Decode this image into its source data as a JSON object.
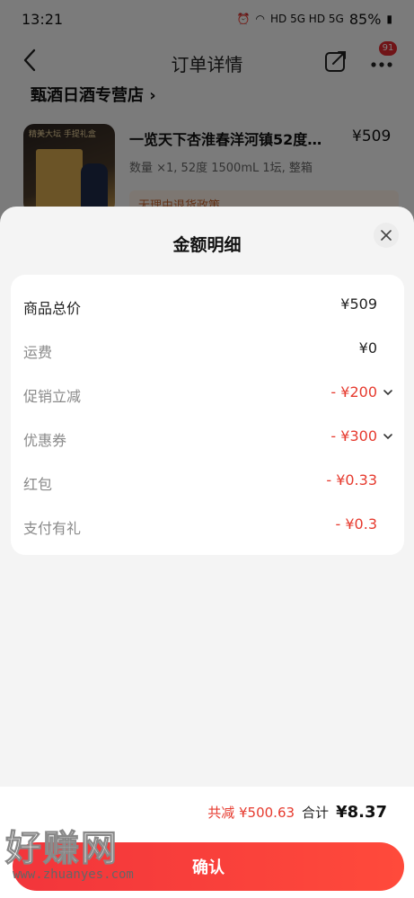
{
  "status_bar": {
    "time": "13:21",
    "network": "HD 5G HD 5G",
    "battery": "85%"
  },
  "nav": {
    "title": "订单详情",
    "badge": "91"
  },
  "store": {
    "name": "甄酒日酒专营店"
  },
  "product": {
    "thumb_label": "精美大坛 手提礼盒",
    "name": "一览天下杏淮春洋河镇52度…",
    "price": "¥509",
    "spec": "数量 ×1, 52度 1500mL 1坛, 整箱",
    "policy": "无理由退货政策"
  },
  "sheet": {
    "title": "金额明细",
    "rows": [
      {
        "label": "商品总价",
        "value": "¥509"
      },
      {
        "label": "运费",
        "value": "¥0"
      },
      {
        "label": "促销立减",
        "value": "- ¥200"
      },
      {
        "label": "优惠券",
        "value": "- ¥300"
      },
      {
        "label": "红包",
        "value": "- ¥0.33"
      },
      {
        "label": "支付有礼",
        "value": "- ¥0.3"
      }
    ]
  },
  "footer": {
    "discount_label": "共减 ¥500.63",
    "total_label": "合计",
    "total_value": "¥8.37",
    "confirm_label": "确认"
  },
  "watermark": {
    "big": "好赚网",
    "small": "www.zhuanyes.com"
  },
  "colors": {
    "accent": "#e63a2e",
    "button": "#f2353b"
  }
}
